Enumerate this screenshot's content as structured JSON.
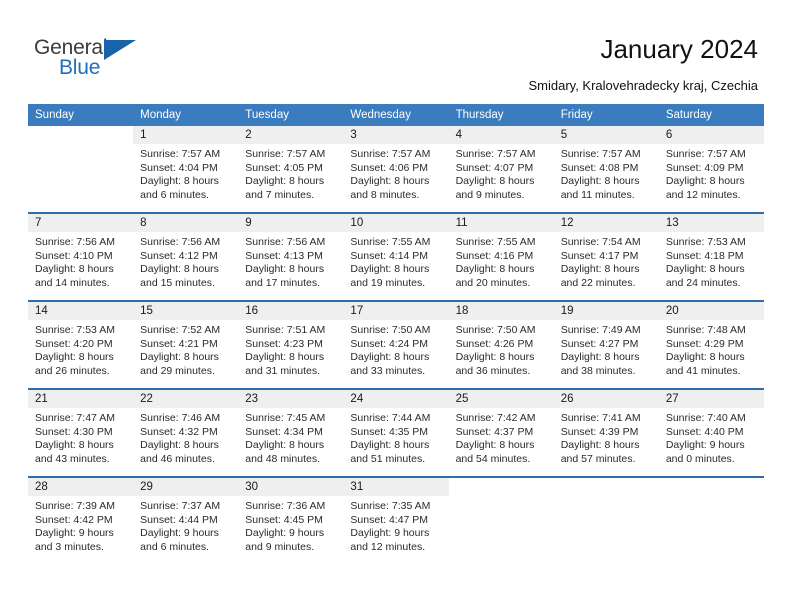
{
  "brand": {
    "name_top": "General",
    "name_bottom": "Blue",
    "triangle_color": "#1565a8",
    "blue_color": "#1f6fbb"
  },
  "header": {
    "title": "January 2024",
    "location": "Smidary, Kralovehradecky kraj, Czechia"
  },
  "theme": {
    "header_bar": "#3a7cbe",
    "week_rule": "#2f6da9",
    "daynum_band": "#efefef"
  },
  "weekday_headers": [
    "Sunday",
    "Monday",
    "Tuesday",
    "Wednesday",
    "Thursday",
    "Friday",
    "Saturday"
  ],
  "labels": {
    "sunrise_prefix": "Sunrise:",
    "sunset_prefix": "Sunset:",
    "daylight_prefix": "Daylight:"
  },
  "weeks": [
    [
      {
        "day": ""
      },
      {
        "day": "1",
        "sunrise": "Sunrise: 7:57 AM",
        "sunset": "Sunset: 4:04 PM",
        "daylight_1": "Daylight: 8 hours",
        "daylight_2": "and 6 minutes."
      },
      {
        "day": "2",
        "sunrise": "Sunrise: 7:57 AM",
        "sunset": "Sunset: 4:05 PM",
        "daylight_1": "Daylight: 8 hours",
        "daylight_2": "and 7 minutes."
      },
      {
        "day": "3",
        "sunrise": "Sunrise: 7:57 AM",
        "sunset": "Sunset: 4:06 PM",
        "daylight_1": "Daylight: 8 hours",
        "daylight_2": "and 8 minutes."
      },
      {
        "day": "4",
        "sunrise": "Sunrise: 7:57 AM",
        "sunset": "Sunset: 4:07 PM",
        "daylight_1": "Daylight: 8 hours",
        "daylight_2": "and 9 minutes."
      },
      {
        "day": "5",
        "sunrise": "Sunrise: 7:57 AM",
        "sunset": "Sunset: 4:08 PM",
        "daylight_1": "Daylight: 8 hours",
        "daylight_2": "and 11 minutes."
      },
      {
        "day": "6",
        "sunrise": "Sunrise: 7:57 AM",
        "sunset": "Sunset: 4:09 PM",
        "daylight_1": "Daylight: 8 hours",
        "daylight_2": "and 12 minutes."
      }
    ],
    [
      {
        "day": "7",
        "sunrise": "Sunrise: 7:56 AM",
        "sunset": "Sunset: 4:10 PM",
        "daylight_1": "Daylight: 8 hours",
        "daylight_2": "and 14 minutes."
      },
      {
        "day": "8",
        "sunrise": "Sunrise: 7:56 AM",
        "sunset": "Sunset: 4:12 PM",
        "daylight_1": "Daylight: 8 hours",
        "daylight_2": "and 15 minutes."
      },
      {
        "day": "9",
        "sunrise": "Sunrise: 7:56 AM",
        "sunset": "Sunset: 4:13 PM",
        "daylight_1": "Daylight: 8 hours",
        "daylight_2": "and 17 minutes."
      },
      {
        "day": "10",
        "sunrise": "Sunrise: 7:55 AM",
        "sunset": "Sunset: 4:14 PM",
        "daylight_1": "Daylight: 8 hours",
        "daylight_2": "and 19 minutes."
      },
      {
        "day": "11",
        "sunrise": "Sunrise: 7:55 AM",
        "sunset": "Sunset: 4:16 PM",
        "daylight_1": "Daylight: 8 hours",
        "daylight_2": "and 20 minutes."
      },
      {
        "day": "12",
        "sunrise": "Sunrise: 7:54 AM",
        "sunset": "Sunset: 4:17 PM",
        "daylight_1": "Daylight: 8 hours",
        "daylight_2": "and 22 minutes."
      },
      {
        "day": "13",
        "sunrise": "Sunrise: 7:53 AM",
        "sunset": "Sunset: 4:18 PM",
        "daylight_1": "Daylight: 8 hours",
        "daylight_2": "and 24 minutes."
      }
    ],
    [
      {
        "day": "14",
        "sunrise": "Sunrise: 7:53 AM",
        "sunset": "Sunset: 4:20 PM",
        "daylight_1": "Daylight: 8 hours",
        "daylight_2": "and 26 minutes."
      },
      {
        "day": "15",
        "sunrise": "Sunrise: 7:52 AM",
        "sunset": "Sunset: 4:21 PM",
        "daylight_1": "Daylight: 8 hours",
        "daylight_2": "and 29 minutes."
      },
      {
        "day": "16",
        "sunrise": "Sunrise: 7:51 AM",
        "sunset": "Sunset: 4:23 PM",
        "daylight_1": "Daylight: 8 hours",
        "daylight_2": "and 31 minutes."
      },
      {
        "day": "17",
        "sunrise": "Sunrise: 7:50 AM",
        "sunset": "Sunset: 4:24 PM",
        "daylight_1": "Daylight: 8 hours",
        "daylight_2": "and 33 minutes."
      },
      {
        "day": "18",
        "sunrise": "Sunrise: 7:50 AM",
        "sunset": "Sunset: 4:26 PM",
        "daylight_1": "Daylight: 8 hours",
        "daylight_2": "and 36 minutes."
      },
      {
        "day": "19",
        "sunrise": "Sunrise: 7:49 AM",
        "sunset": "Sunset: 4:27 PM",
        "daylight_1": "Daylight: 8 hours",
        "daylight_2": "and 38 minutes."
      },
      {
        "day": "20",
        "sunrise": "Sunrise: 7:48 AM",
        "sunset": "Sunset: 4:29 PM",
        "daylight_1": "Daylight: 8 hours",
        "daylight_2": "and 41 minutes."
      }
    ],
    [
      {
        "day": "21",
        "sunrise": "Sunrise: 7:47 AM",
        "sunset": "Sunset: 4:30 PM",
        "daylight_1": "Daylight: 8 hours",
        "daylight_2": "and 43 minutes."
      },
      {
        "day": "22",
        "sunrise": "Sunrise: 7:46 AM",
        "sunset": "Sunset: 4:32 PM",
        "daylight_1": "Daylight: 8 hours",
        "daylight_2": "and 46 minutes."
      },
      {
        "day": "23",
        "sunrise": "Sunrise: 7:45 AM",
        "sunset": "Sunset: 4:34 PM",
        "daylight_1": "Daylight: 8 hours",
        "daylight_2": "and 48 minutes."
      },
      {
        "day": "24",
        "sunrise": "Sunrise: 7:44 AM",
        "sunset": "Sunset: 4:35 PM",
        "daylight_1": "Daylight: 8 hours",
        "daylight_2": "and 51 minutes."
      },
      {
        "day": "25",
        "sunrise": "Sunrise: 7:42 AM",
        "sunset": "Sunset: 4:37 PM",
        "daylight_1": "Daylight: 8 hours",
        "daylight_2": "and 54 minutes."
      },
      {
        "day": "26",
        "sunrise": "Sunrise: 7:41 AM",
        "sunset": "Sunset: 4:39 PM",
        "daylight_1": "Daylight: 8 hours",
        "daylight_2": "and 57 minutes."
      },
      {
        "day": "27",
        "sunrise": "Sunrise: 7:40 AM",
        "sunset": "Sunset: 4:40 PM",
        "daylight_1": "Daylight: 9 hours",
        "daylight_2": "and 0 minutes."
      }
    ],
    [
      {
        "day": "28",
        "sunrise": "Sunrise: 7:39 AM",
        "sunset": "Sunset: 4:42 PM",
        "daylight_1": "Daylight: 9 hours",
        "daylight_2": "and 3 minutes."
      },
      {
        "day": "29",
        "sunrise": "Sunrise: 7:37 AM",
        "sunset": "Sunset: 4:44 PM",
        "daylight_1": "Daylight: 9 hours",
        "daylight_2": "and 6 minutes."
      },
      {
        "day": "30",
        "sunrise": "Sunrise: 7:36 AM",
        "sunset": "Sunset: 4:45 PM",
        "daylight_1": "Daylight: 9 hours",
        "daylight_2": "and 9 minutes."
      },
      {
        "day": "31",
        "sunrise": "Sunrise: 7:35 AM",
        "sunset": "Sunset: 4:47 PM",
        "daylight_1": "Daylight: 9 hours",
        "daylight_2": "and 12 minutes."
      },
      {
        "day": ""
      },
      {
        "day": ""
      },
      {
        "day": ""
      }
    ]
  ]
}
